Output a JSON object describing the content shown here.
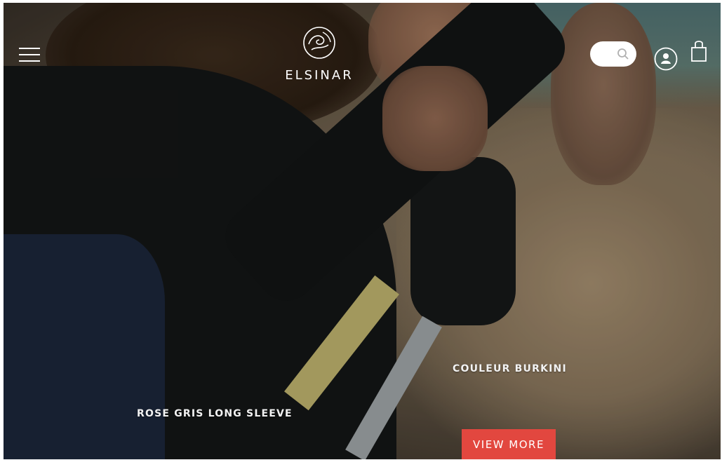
{
  "brand": {
    "name": "ELSINAR",
    "logo_icon": "globe-wave-emblem"
  },
  "header": {
    "menu_icon": "hamburger-menu-icon",
    "search": {
      "placeholder": "",
      "value": "",
      "icon": "search-icon"
    },
    "account_icon": "user-circle-icon",
    "bag_icon": "shopping-bag-icon"
  },
  "hero": {
    "product_labels": [
      "ROSE GRIS LONG SLEEVE",
      "COULEUR BURKINI"
    ],
    "cta_label": "VIEW MORE"
  },
  "colors": {
    "accent": "#e2473f",
    "text": "#ffffff"
  }
}
